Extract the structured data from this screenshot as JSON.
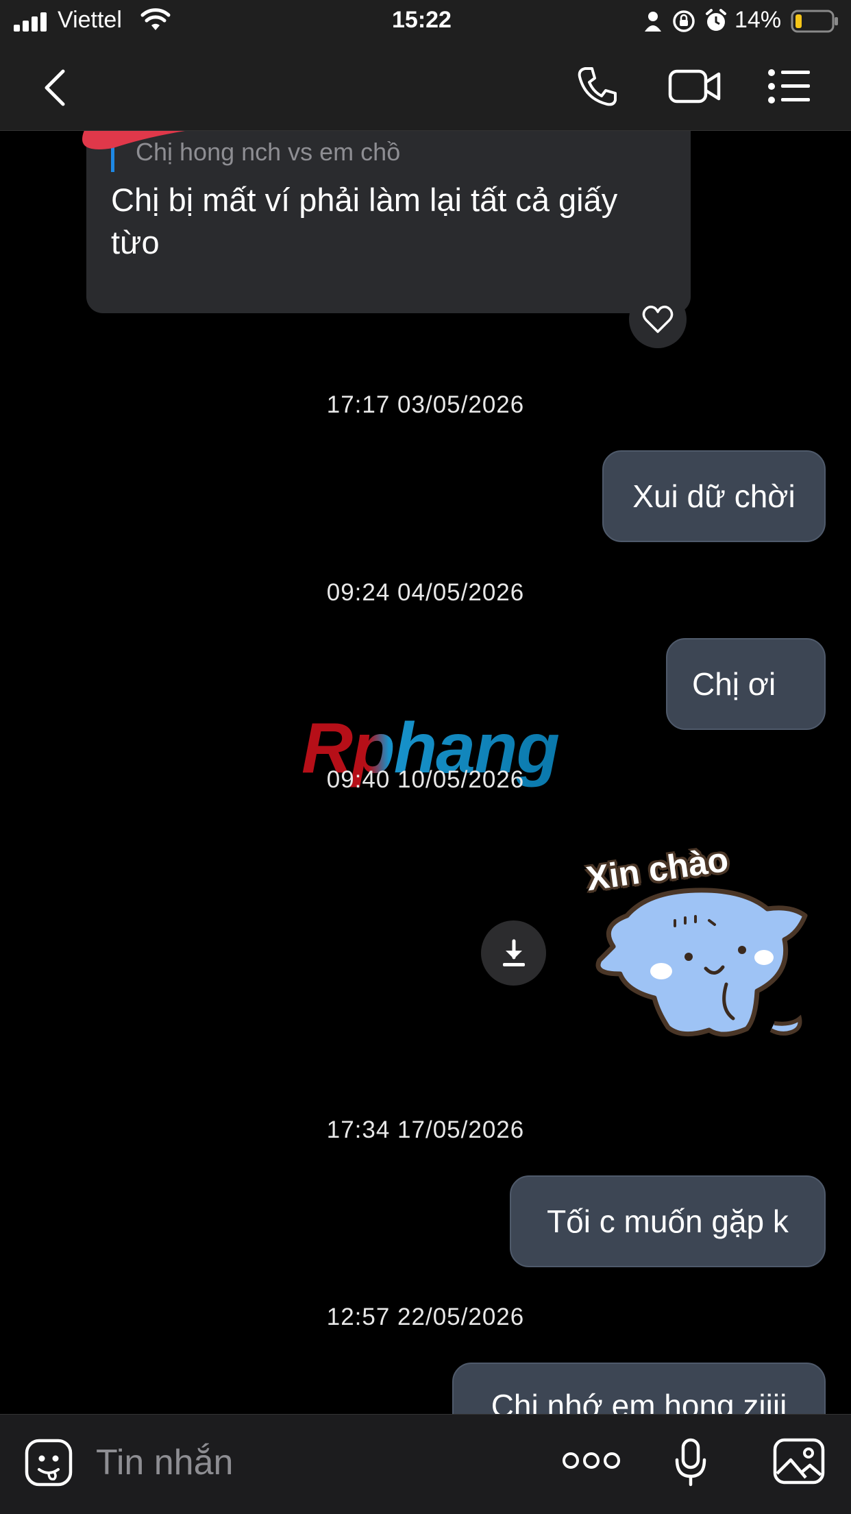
{
  "status_bar": {
    "carrier": "Viettel",
    "time": "15:22",
    "battery": "14%"
  },
  "header": {
    "contact_name": ""
  },
  "reply_preview": {
    "quoted_label": "Chị hong nch vs em chồ",
    "message": "Chị bị mất ví phải làm lại tất cả giấy từo"
  },
  "messages": [
    {
      "timestamp": "17:17 03/05/2026",
      "text": "Xui dữ chời"
    },
    {
      "timestamp": "09:24 04/05/2026",
      "text": "Chị ơi"
    },
    {
      "timestamp": "09:40 10/05/2026",
      "sticker_text": "Xin chào"
    },
    {
      "timestamp": "17:34 17/05/2026",
      "text": "Tối c muốn gặp k"
    },
    {
      "timestamp": "12:57 22/05/2026",
      "text": "Chị nhớ em hong ziiii"
    }
  ],
  "watermark": "Rphang",
  "composer": {
    "placeholder": "Tin nhắn"
  },
  "colors": {
    "background": "#000000",
    "bar": "#1f1f1f",
    "incoming_bubble": "#2a2b2e",
    "outgoing_bubble": "#3d4654",
    "redaction": "#e0384a",
    "sticker_blue": "#9ec3f5"
  }
}
